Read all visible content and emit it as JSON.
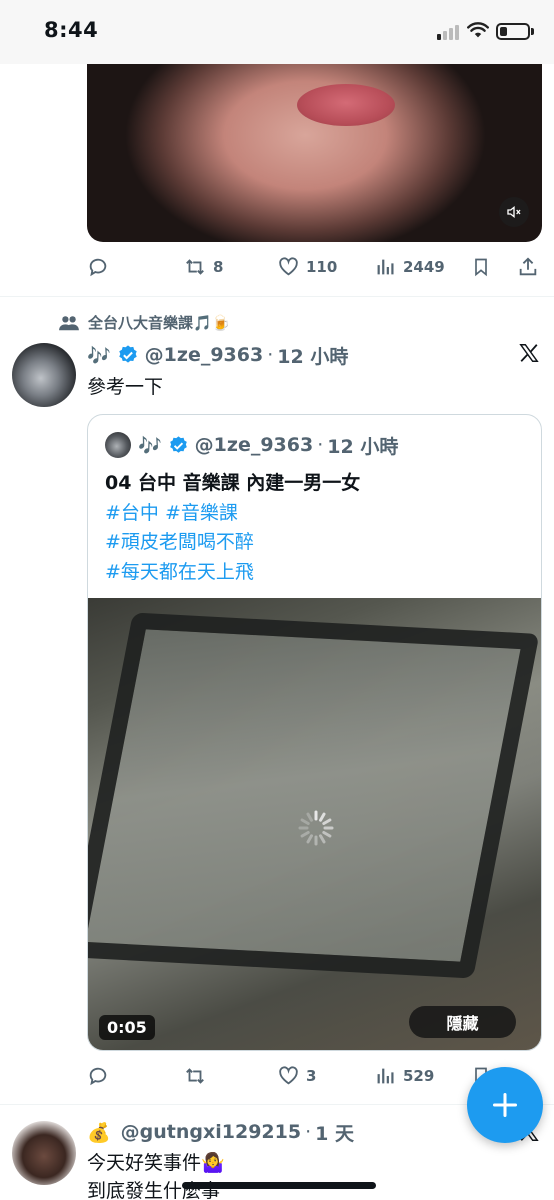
{
  "status_bar": {
    "time": "8:44"
  },
  "top_tweet": {
    "stats": {
      "retweets": "8",
      "likes": "110",
      "views": "2449"
    }
  },
  "tweet2": {
    "context": "全台八大音樂課🎵🍺",
    "display_name": "🎶",
    "handle": "@1ze_9363",
    "separator": "·",
    "time": "12 小時",
    "text": "參考一下",
    "quote": {
      "display_name": "🎶",
      "handle": "@1ze_9363",
      "separator": "·",
      "time": "12 小時",
      "line1": "04 台中 音樂課 內建一男一女",
      "hashtags_line1": "#台中 #音樂課",
      "hashtags_line2": "#頑皮老闆喝不醉",
      "hashtags_line3": "#每天都在天上飛",
      "video_time": "0:05",
      "hide_label": "隱藏"
    },
    "stats": {
      "replies": "",
      "retweets": "",
      "likes": "3",
      "views": "529"
    }
  },
  "tweet3": {
    "badge": "💰",
    "handle": "@gutngxi129215",
    "separator": "·",
    "time": "1 天",
    "line1": "今天好笑事件🤷‍♀️",
    "line2": "到底發生什麼事"
  },
  "colors": {
    "accent": "#1d9bf0",
    "secondary_text": "#536471",
    "divider": "#eff3f4"
  },
  "icons": [
    "reply-icon",
    "retweet-icon",
    "like-icon",
    "views-icon",
    "bookmark-icon",
    "share-icon",
    "verified-icon",
    "x-logo-icon",
    "mute-icon",
    "compose-plus-icon",
    "community-icon"
  ]
}
